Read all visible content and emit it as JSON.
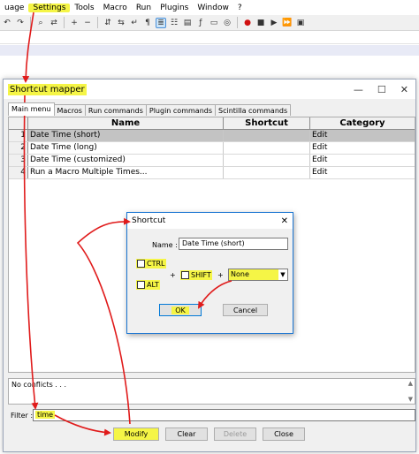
{
  "menubar": {
    "items": [
      {
        "label": "uage",
        "highlight": false
      },
      {
        "label": "Settings",
        "highlight": true
      },
      {
        "label": "Tools",
        "highlight": false
      },
      {
        "label": "Macro",
        "highlight": false
      },
      {
        "label": "Run",
        "highlight": false
      },
      {
        "label": "Plugins",
        "highlight": false
      },
      {
        "label": "Window",
        "highlight": false
      },
      {
        "label": "?",
        "highlight": false
      }
    ]
  },
  "mapper": {
    "title": "Shortcut mapper",
    "tabs": [
      "Main menu",
      "Macros",
      "Run commands",
      "Plugin commands",
      "Scintilla commands"
    ],
    "columns": {
      "name": "Name",
      "shortcut": "Shortcut",
      "category": "Category"
    },
    "rows": [
      {
        "num": "1",
        "name": "Date Time (short)",
        "shortcut": "",
        "category": "Edit",
        "selected": true
      },
      {
        "num": "2",
        "name": "Date Time (long)",
        "shortcut": "",
        "category": "Edit",
        "selected": false
      },
      {
        "num": "3",
        "name": "Date Time (customized)",
        "shortcut": "",
        "category": "Edit",
        "selected": false
      },
      {
        "num": "4",
        "name": "Run a Macro Multiple Times...",
        "shortcut": "",
        "category": "Edit",
        "selected": false
      }
    ],
    "conflicts_text": "No conflicts . . .",
    "filter_label": "Filter :",
    "filter_value": "time",
    "buttons": {
      "modify": "Modify",
      "clear": "Clear",
      "delete": "Delete",
      "close": "Close"
    }
  },
  "dialog": {
    "title": "Shortcut",
    "name_label": "Name :",
    "name_value": "Date Time (short)",
    "ctrl_label": "CTRL",
    "alt_label": "ALT",
    "shift_label": "SHIFT",
    "plus": "+",
    "key_value": "None",
    "ok_label": "OK",
    "cancel_label": "Cancel"
  },
  "colors": {
    "highlight": "#f5f546",
    "annotation_arrow": "#e01b1b",
    "selected_row": "#c3c3c3"
  }
}
